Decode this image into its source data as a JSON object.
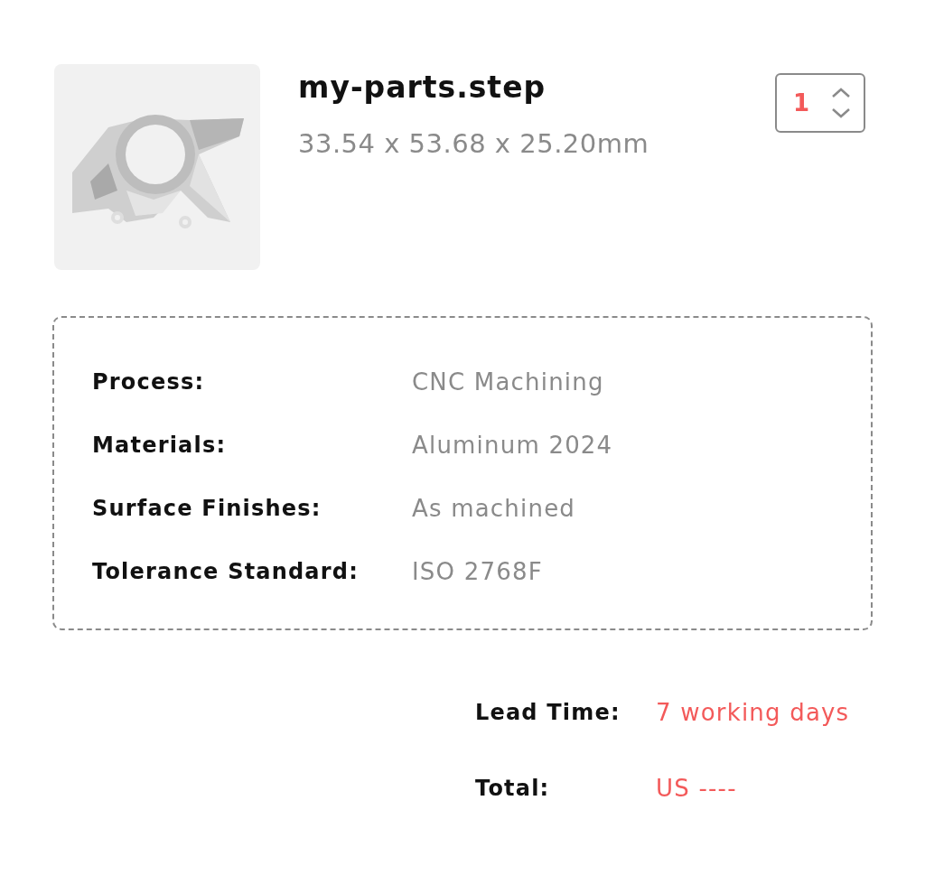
{
  "part": {
    "file_name": "my-parts.step",
    "dimensions": "33.54 x 53.68 x 25.20mm",
    "quantity": "1"
  },
  "specs": [
    {
      "label": "Process:",
      "value": "CNC Machining"
    },
    {
      "label": "Materials:",
      "value": "Aluminum 2024"
    },
    {
      "label": "Surface Finishes:",
      "value": "As machined"
    },
    {
      "label": "Tolerance Standard:",
      "value": "ISO 2768F"
    }
  ],
  "summary": [
    {
      "label": "Lead Time:",
      "value": "7 working days"
    },
    {
      "label": "Total:",
      "value": "US ----"
    }
  ]
}
